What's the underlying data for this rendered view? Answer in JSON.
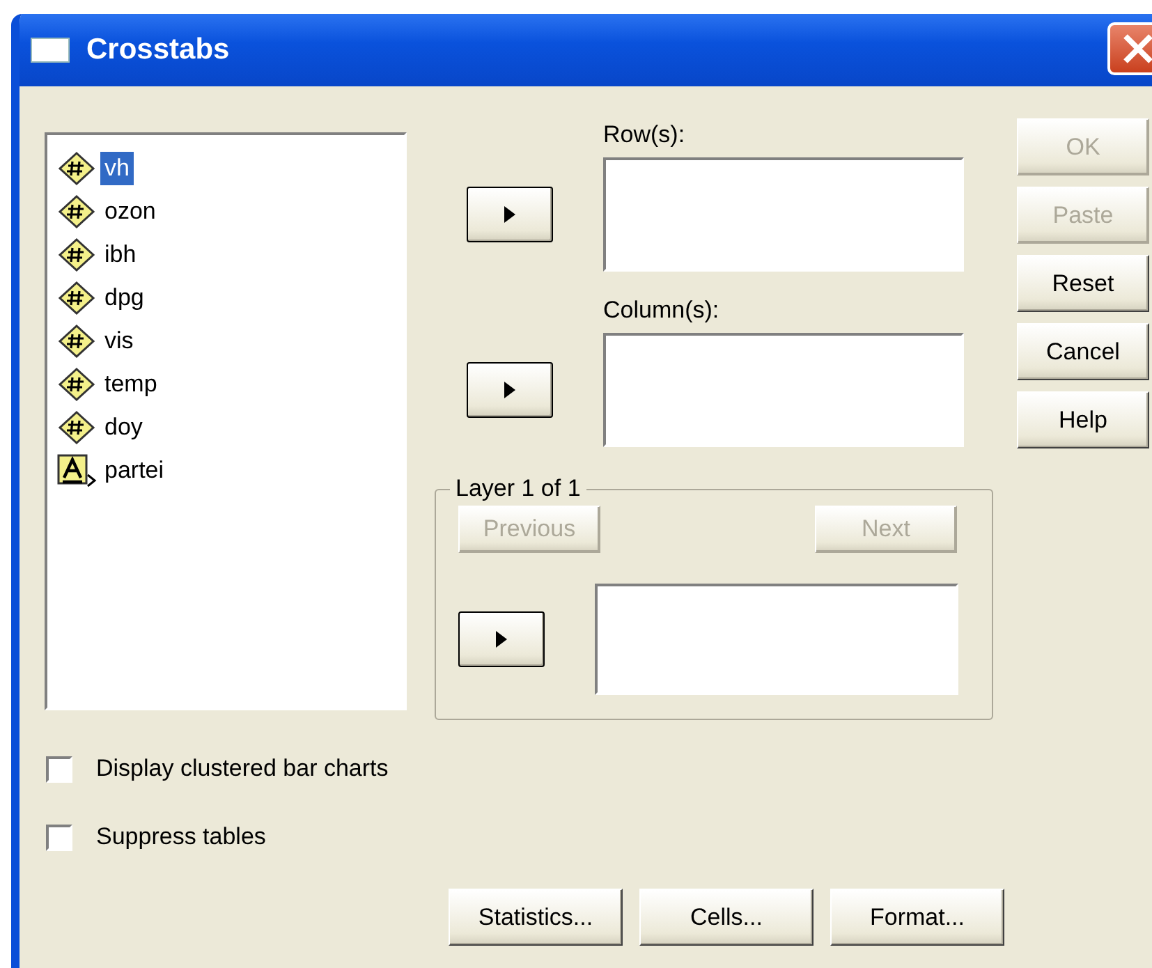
{
  "window": {
    "title": "Crosstabs"
  },
  "variables": [
    {
      "name": "vh",
      "kind": "numeric",
      "selected": true
    },
    {
      "name": "ozon",
      "kind": "numeric",
      "selected": false
    },
    {
      "name": "ibh",
      "kind": "numeric",
      "selected": false
    },
    {
      "name": "dpg",
      "kind": "numeric",
      "selected": false
    },
    {
      "name": "vis",
      "kind": "numeric",
      "selected": false
    },
    {
      "name": "temp",
      "kind": "numeric",
      "selected": false
    },
    {
      "name": "doy",
      "kind": "numeric",
      "selected": false
    },
    {
      "name": "partei",
      "kind": "string",
      "selected": false
    }
  ],
  "rows_label": "Row(s):",
  "columns_label": "Column(s):",
  "layer": {
    "title": "Layer 1 of 1",
    "previous": {
      "label": "Previous",
      "disabled": true
    },
    "next": {
      "label": "Next",
      "disabled": true
    }
  },
  "side_buttons": [
    {
      "label": "OK",
      "disabled": true
    },
    {
      "label": "Paste",
      "disabled": true
    },
    {
      "label": "Reset",
      "disabled": false
    },
    {
      "label": "Cancel",
      "disabled": false
    },
    {
      "label": "Help",
      "disabled": false
    }
  ],
  "options": [
    {
      "label": "Display clustered bar charts",
      "checked": false
    },
    {
      "label": "Suppress tables",
      "checked": false
    }
  ],
  "bottom_buttons": [
    {
      "label": "Statistics...",
      "disabled": false
    },
    {
      "label": "Cells...",
      "disabled": false
    },
    {
      "label": "Format...",
      "disabled": false
    }
  ]
}
